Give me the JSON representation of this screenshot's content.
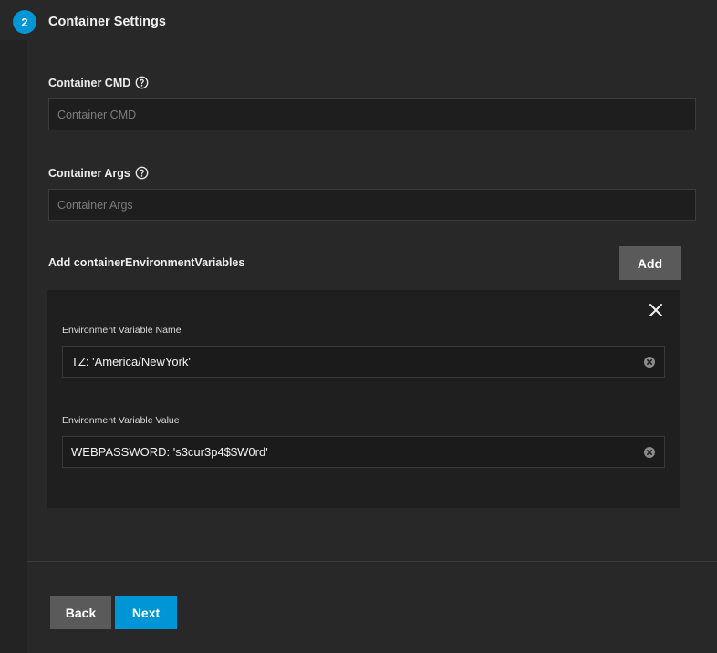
{
  "step": {
    "number": "2",
    "title": "Container Settings"
  },
  "fields": {
    "cmd": {
      "label": "Container CMD",
      "placeholder": "Container CMD",
      "value": "",
      "help_icon": "help-circle-icon"
    },
    "args": {
      "label": "Container Args",
      "placeholder": "Container Args",
      "value": "",
      "help_icon": "help-circle-icon"
    }
  },
  "env": {
    "section_label": "Add containerEnvironmentVariables",
    "add_label": "Add",
    "items": [
      {
        "name_label": "Environment Variable Name",
        "name_value": "TZ: 'America/NewYork'",
        "value_label": "Environment Variable Value",
        "value_value": "WEBPASSWORD: 's3cur3p4$$W0rd'"
      }
    ]
  },
  "buttons": {
    "back": "Back",
    "next": "Next"
  },
  "colors": {
    "accent": "#0095d5",
    "background": "#282828",
    "panel": "#1f1f1f",
    "secondary_button": "#5a5a5a"
  }
}
